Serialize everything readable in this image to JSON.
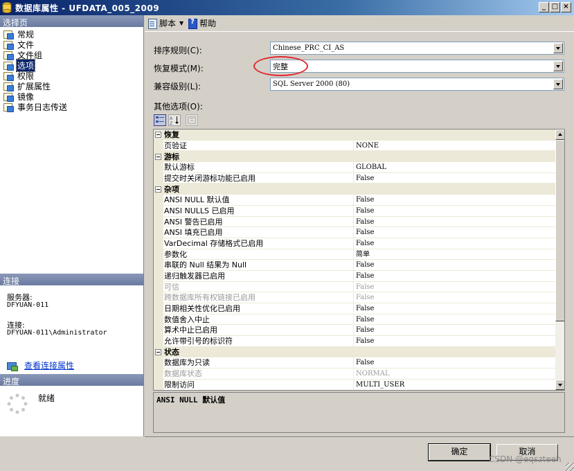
{
  "window": {
    "title": "数据库属性 - UFDATA_005_2009",
    "minimize": "_",
    "maximize": "□",
    "close": "×"
  },
  "sidebar": {
    "pages_header": "选择页",
    "pages": [
      {
        "label": "常规",
        "selected": false
      },
      {
        "label": "文件",
        "selected": false
      },
      {
        "label": "文件组",
        "selected": false
      },
      {
        "label": "选项",
        "selected": true
      },
      {
        "label": "权限",
        "selected": false
      },
      {
        "label": "扩展属性",
        "selected": false
      },
      {
        "label": "镜像",
        "selected": false
      },
      {
        "label": "事务日志传送",
        "selected": false
      }
    ],
    "connection_header": "连接",
    "server_label": "服务器:",
    "server_value": "DFYUAN-011",
    "connection_label": "连接:",
    "connection_value": "DFYUAN-011\\Administrator",
    "view_connection_link": "查看连接属性",
    "progress_header": "进度",
    "progress_status": "就绪"
  },
  "toolbar": {
    "script_label": "脚本",
    "help_label": "帮助"
  },
  "form": {
    "collation_label": "排序规则(C):",
    "collation_value": "Chinese_PRC_CI_AS",
    "recovery_label": "恢复模式(M):",
    "recovery_value": "完整",
    "compat_label": "兼容级别(L):",
    "compat_value": "SQL Server 2000 (80)",
    "other_options_label": "其他选项(O):"
  },
  "property_grid": {
    "groups": [
      {
        "name": "恢复",
        "rows": [
          {
            "name": "页验证",
            "value": "NONE",
            "dim": false
          }
        ]
      },
      {
        "name": "游标",
        "rows": [
          {
            "name": "默认游标",
            "value": "GLOBAL",
            "dim": false
          },
          {
            "name": "提交时关闭游标功能已启用",
            "value": "False",
            "dim": false
          }
        ]
      },
      {
        "name": "杂项",
        "rows": [
          {
            "name": "ANSI NULL 默认值",
            "value": "False",
            "dim": false
          },
          {
            "name": "ANSI NULLS 已启用",
            "value": "False",
            "dim": false
          },
          {
            "name": "ANSI 警告已启用",
            "value": "False",
            "dim": false
          },
          {
            "name": "ANSI 填充已启用",
            "value": "False",
            "dim": false
          },
          {
            "name": "VarDecimal 存储格式已启用",
            "value": "False",
            "dim": false
          },
          {
            "name": "参数化",
            "value": "简单",
            "dim": false
          },
          {
            "name": "串联的 Null 结果为 Null",
            "value": "False",
            "dim": false
          },
          {
            "name": "递归触发器已启用",
            "value": "False",
            "dim": false
          },
          {
            "name": "可信",
            "value": "False",
            "dim": true
          },
          {
            "name": "跨数据库所有权链接已启用",
            "value": "False",
            "dim": true
          },
          {
            "name": "日期相关性优化已启用",
            "value": "False",
            "dim": false
          },
          {
            "name": "数值舍入中止",
            "value": "False",
            "dim": false
          },
          {
            "name": "算术中止已启用",
            "value": "False",
            "dim": false
          },
          {
            "name": "允许带引号的标识符",
            "value": "False",
            "dim": false
          }
        ]
      },
      {
        "name": "状态",
        "rows": [
          {
            "name": "数据库为只读",
            "value": "False",
            "dim": false
          },
          {
            "name": "数据库状态",
            "value": "NORMAL",
            "dim": true
          },
          {
            "name": "限制访问",
            "value": "MULTI_USER",
            "dim": false
          }
        ]
      }
    ],
    "description": "ANSI NULL 默认值"
  },
  "buttons": {
    "ok": "确定",
    "cancel": "取消"
  },
  "watermark": "CSDN @eqszteeh",
  "colors": {
    "title_gradient_start": "#0a246a",
    "selection": "#0a246a",
    "annotation_circle": "#e0282e",
    "link": "#0033cc"
  }
}
